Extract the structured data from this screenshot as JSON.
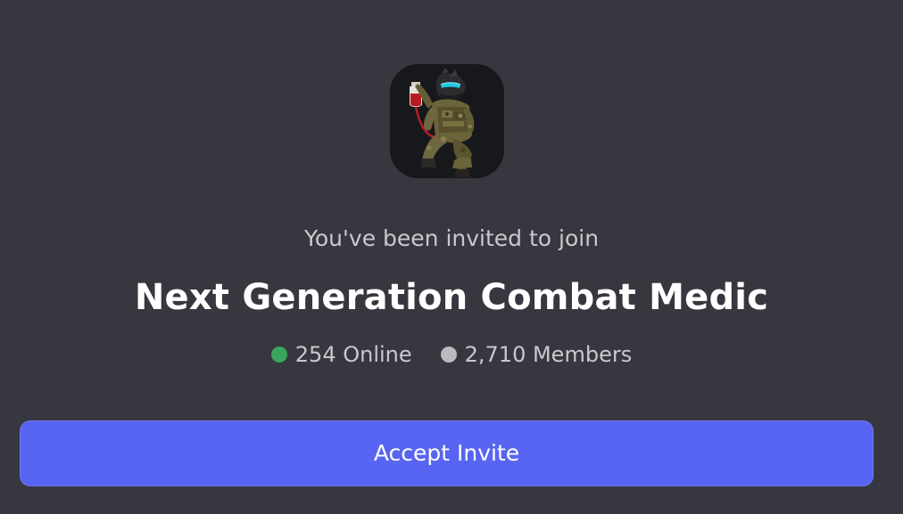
{
  "invite": {
    "intro_text": "You've been invited to join",
    "server_name": "Next Generation Combat Medic",
    "server_icon": "combat-medic-avatar",
    "online": {
      "label": "254 Online",
      "dot_color": "#3ba55d"
    },
    "members": {
      "label": "2,710 Members",
      "dot_color": "#b9bbbe"
    },
    "accept_button_label": "Accept Invite"
  },
  "colors": {
    "background": "#37373f",
    "accent": "#5865f2"
  }
}
